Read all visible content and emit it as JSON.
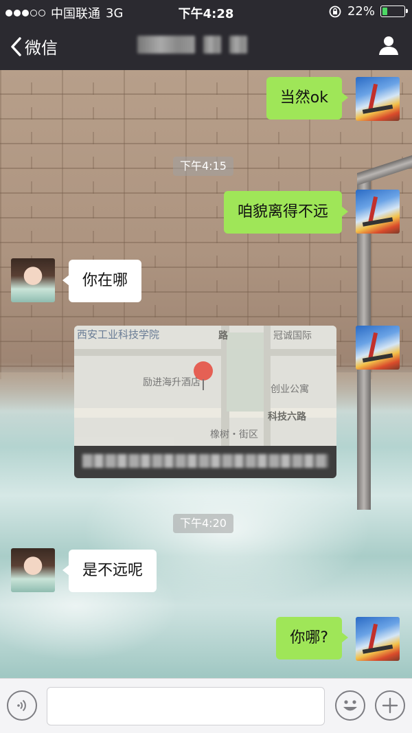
{
  "status_bar": {
    "carrier": "中国联通",
    "network": "3G",
    "time": "下午4:28",
    "battery_percent": "22%",
    "battery_level": 0.22,
    "signal_filled": 3,
    "signal_total": 5
  },
  "nav": {
    "back_label": "微信"
  },
  "messages": {
    "m1": "当然ok",
    "ts1": "下午4:15",
    "m2": "咱貌离得不远",
    "m3": "你在哪",
    "ts2": "下午4:20",
    "m4": "是不远呢",
    "m5": "你哪?"
  },
  "map": {
    "label_1": "西安工业科技学院",
    "label_2": "路",
    "label_3": "冠诚国际",
    "label_4": "励进海升酒店",
    "label_5": "创业公寓",
    "label_6": "科技六路",
    "label_7": "橡树・街区"
  },
  "colors": {
    "nav_bg": "#2b2a30",
    "sent_bubble": "#9fe658",
    "received_bubble": "#ffffff",
    "battery_fill": "#4cd964",
    "pin": "#e84b3f"
  }
}
